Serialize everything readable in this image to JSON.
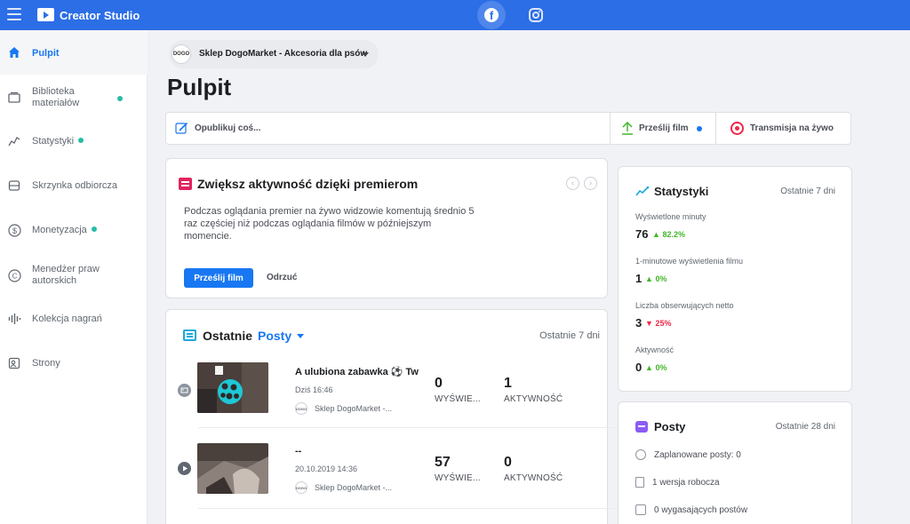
{
  "app": {
    "title": "Creator Studio"
  },
  "topbar": {
    "platforms": [
      "facebook",
      "instagram"
    ]
  },
  "sidebar": {
    "items": [
      {
        "label": "Pulpit",
        "icon": "home-icon",
        "active": true,
        "dot": false
      },
      {
        "label": "Biblioteka\nmateriałów",
        "icon": "library-icon",
        "active": false,
        "dot": true
      },
      {
        "label": "Statystyki",
        "icon": "chart-icon",
        "active": false,
        "dot": true
      },
      {
        "label": "Skrzynka odbiorcza",
        "icon": "inbox-icon",
        "active": false,
        "dot": false
      },
      {
        "label": "Monetyzacja",
        "icon": "dollar-icon",
        "active": false,
        "dot": true
      },
      {
        "label": "Menedżer praw\nautorskich",
        "icon": "copyright-icon",
        "active": false,
        "dot": false
      },
      {
        "label": "Kolekcja nagrań",
        "icon": "audio-icon",
        "active": false,
        "dot": false
      },
      {
        "label": "Strony",
        "icon": "pages-icon",
        "active": false,
        "dot": false
      }
    ]
  },
  "page_selector": {
    "name": "Sklep DogoMarket - Akcesoria dla psów",
    "avatar_text": "DOGO"
  },
  "page_title": "Pulpit",
  "actions": {
    "compose": "Opublikuj coś...",
    "upload": "Prześlij film",
    "live": "Transmisja na żywo"
  },
  "premiere": {
    "title": "Zwiększ aktywność dzięki premierom",
    "body": "Podczas oglądania premier na żywo widzowie komentują średnio 5 raz częściej niż podczas oglądania filmów w późniejszym momencie.",
    "primary": "Prześlij film",
    "secondary": "Odrzuć",
    "prev": "‹",
    "next": "›"
  },
  "recent": {
    "title": "Ostatnie",
    "filter": "Posty",
    "period": "Ostatnie 7 dni",
    "posts": [
      {
        "type": "photo",
        "title": "A ulubiona zabawka ⚽ Tw",
        "date": "Dziś 16:46",
        "page": "Sklep DogoMarket -...",
        "views": "0",
        "views_label": "WYŚWIE...",
        "engagement": "1",
        "engagement_label": "AKTYWNOŚĆ"
      },
      {
        "type": "video",
        "title": "--",
        "date": "20.10.2019 14:36",
        "page": "Sklep DogoMarket -...",
        "views": "57",
        "views_label": "WYŚWIE...",
        "engagement": "0",
        "engagement_label": "AKTYWNOŚĆ"
      }
    ]
  },
  "stats": {
    "title": "Statystyki",
    "period": "Ostatnie 7 dni",
    "items": [
      {
        "label": "Wyświetlone minuty",
        "value": "76",
        "change": "82.2%",
        "direction": "up"
      },
      {
        "label": "1-minutowe wyświetlenia filmu",
        "value": "1",
        "change": "0%",
        "direction": "up"
      },
      {
        "label": "Liczba obserwujących netto",
        "value": "3",
        "change": "25%",
        "direction": "down"
      },
      {
        "label": "Aktywność",
        "value": "0",
        "change": "0%",
        "direction": "up"
      }
    ]
  },
  "posts_card": {
    "title": "Posty",
    "period": "Ostatnie 28 dni",
    "items": [
      {
        "label": "Zaplanowane posty: 0",
        "icon": "clock-icon"
      },
      {
        "label": "1 wersja robocza",
        "icon": "draft-icon"
      },
      {
        "label": "0 wygasających postów",
        "icon": "expiring-icon"
      }
    ]
  },
  "colors": {
    "brand": "#2c6ee6",
    "accent": "#1877f2",
    "up": "#42b72a",
    "down": "#f02849"
  }
}
